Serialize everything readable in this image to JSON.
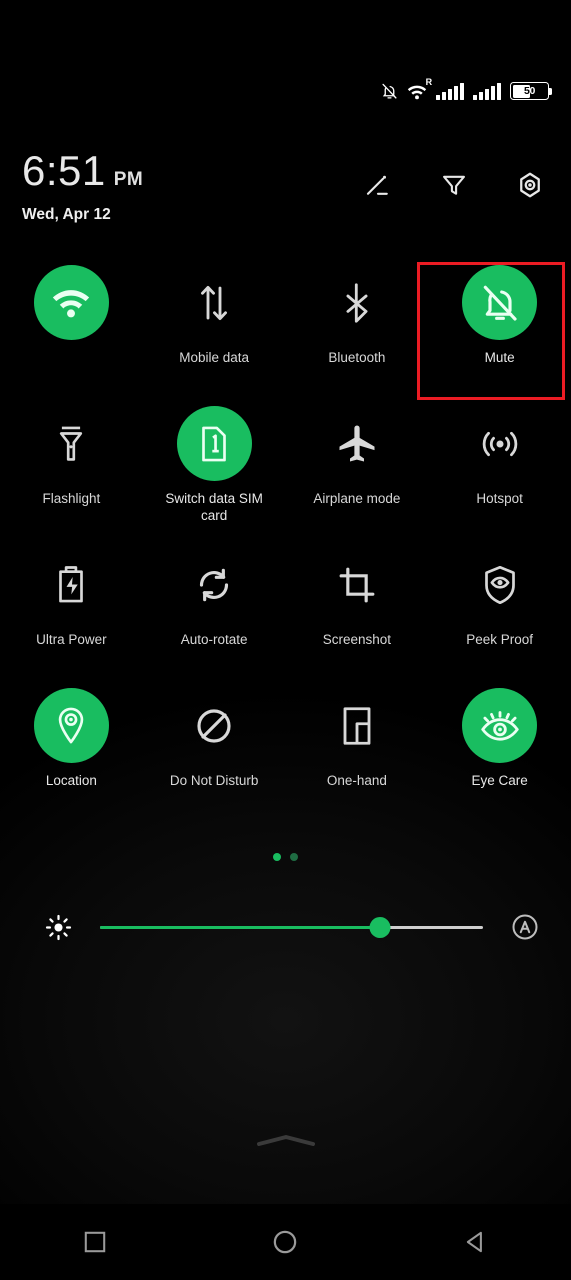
{
  "status_bar": {
    "notification_icon": "bell-muted-icon",
    "wifi_icon": "wifi-roaming-icon",
    "wifi_superscript": "R",
    "signal_1_icon": "signal-bars-icon",
    "signal_2_icon": "signal-bars-icon",
    "battery_level": "50",
    "battery_icon": "battery-icon"
  },
  "header": {
    "time": "6:51",
    "ampm": "PM",
    "date": "Wed, Apr 12",
    "icons": [
      {
        "name": "edit-icon",
        "label": "Edit"
      },
      {
        "name": "filter-icon",
        "label": "Filter"
      },
      {
        "name": "settings-hex-icon",
        "label": "Settings"
      }
    ]
  },
  "tiles": [
    {
      "label": "",
      "icon": "wifi-icon",
      "state": "on"
    },
    {
      "label": "Mobile data",
      "icon": "mobile-data-icon",
      "state": "off"
    },
    {
      "label": "Bluetooth",
      "icon": "bluetooth-icon",
      "state": "off"
    },
    {
      "label": "Mute",
      "icon": "bell-muted-icon",
      "state": "on",
      "highlighted": true
    },
    {
      "label": "Flashlight",
      "icon": "flashlight-icon",
      "state": "off"
    },
    {
      "label": "Switch data SIM card",
      "icon": "sim-card-1-icon",
      "state": "on"
    },
    {
      "label": "Airplane mode",
      "icon": "airplane-icon",
      "state": "off"
    },
    {
      "label": "Hotspot",
      "icon": "hotspot-icon",
      "state": "off"
    },
    {
      "label": "Ultra Power",
      "icon": "battery-bolt-icon",
      "state": "off"
    },
    {
      "label": "Auto-rotate",
      "icon": "auto-rotate-icon",
      "state": "off"
    },
    {
      "label": "Screenshot",
      "icon": "screenshot-crop-icon",
      "state": "off"
    },
    {
      "label": "Peek Proof",
      "icon": "shield-eye-icon",
      "state": "off"
    },
    {
      "label": "Location",
      "icon": "location-pin-icon",
      "state": "on"
    },
    {
      "label": "Do Not Disturb",
      "icon": "do-not-disturb-icon",
      "state": "off"
    },
    {
      "label": "One-hand",
      "icon": "one-hand-icon",
      "state": "off"
    },
    {
      "label": "Eye Care",
      "icon": "eye-care-icon",
      "state": "on"
    }
  ],
  "pager": {
    "pages": 2,
    "active_page": 1
  },
  "brightness": {
    "icon": "brightness-sun-icon",
    "value_percent": 73,
    "auto_icon": "auto-brightness-icon"
  },
  "panel_handle": {
    "icon": "chevron-up-icon"
  },
  "nav_bar": [
    {
      "name": "recents-button",
      "icon": "square-icon"
    },
    {
      "name": "home-button",
      "icon": "circle-icon"
    },
    {
      "name": "back-button",
      "icon": "triangle-left-icon"
    }
  ],
  "colors": {
    "accent_green": "#19bd60",
    "highlight_red": "#ec1c24",
    "background": "#000000",
    "icon_inactive": "#d8d8d8"
  }
}
